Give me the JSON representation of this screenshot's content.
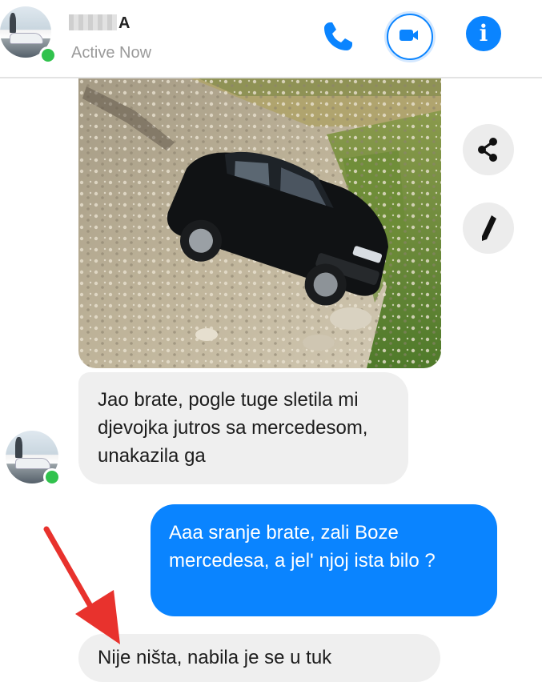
{
  "header": {
    "contact_name": "A",
    "status": "Active Now",
    "call_button": "phone-icon",
    "video_button": "video-camera-icon",
    "info_button": "info-icon",
    "info_glyph": "i"
  },
  "colors": {
    "accent": "#0a84ff",
    "online": "#31c24d",
    "incoming_bubble": "#efefef",
    "annotation_arrow": "#e8322d"
  },
  "photo_actions": {
    "share_icon": "share-icon",
    "edit_icon": "pencil-icon"
  },
  "messages": [
    {
      "direction": "incoming",
      "text": "Jao brate, pogle tuge sletila mi djevojka jutros sa mercedesom, unakazila ga"
    },
    {
      "direction": "outgoing",
      "text": "Aaa sranje brate, zali Boze mercedesa, a jel' njoj ista bilo ?"
    },
    {
      "direction": "incoming",
      "text": "Nije ništa, nabila je se u tuk"
    }
  ],
  "annotation": {
    "icon": "red-arrow-icon"
  }
}
